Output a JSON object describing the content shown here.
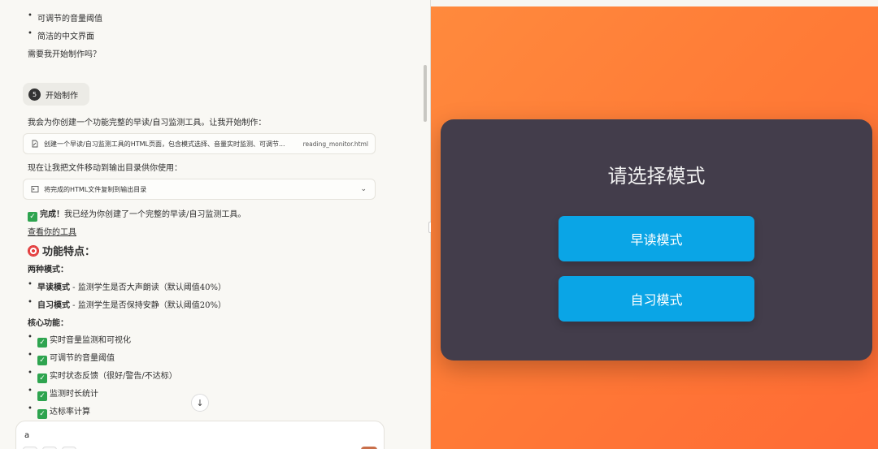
{
  "chat": {
    "lines_top": [
      "可调节的音量阈值",
      "简洁的中文界面"
    ],
    "question": "需要我开始制作吗？",
    "step": {
      "number": "5",
      "label": "开始制作"
    },
    "intro": "我会为你创建一个功能完整的早读/自习监测工具。让我开始制作：",
    "tool1": {
      "text": "创建一个早读/自习监测工具的HTML页面，包含模式选择、音量实时监测、可调节...",
      "file": "reading_monitor.html"
    },
    "move_text": "现在让我把文件移动到输出目录供你使用：",
    "tool2": {
      "text": "将完成的HTML文件复制到输出目录"
    },
    "done_bold": "完成！",
    "done_text": "我已经为你创建了一个完整的早读/自习监测工具。",
    "view_link": "查看你的工具",
    "features_heading": "功能特点：",
    "modes_heading": "两种模式：",
    "modes": [
      {
        "name": "早读模式",
        "desc": " - 监测学生是否大声朗读（默认阈值40%）"
      },
      {
        "name": "自习模式",
        "desc": " - 监测学生是否保持安静（默认阈值20%）"
      }
    ],
    "core_heading": "核心功能：",
    "core": [
      "实时音量监测和可视化",
      "可调节的音量阈值",
      "实时状态反馈（很好/警告/不达标）",
      "监测时长统计",
      "达标率计算"
    ],
    "composer_value": "a",
    "scroll_down_glyph": "↓",
    "check_glyph": "✓",
    "chevron_glyph": "⌄"
  },
  "preview": {
    "title": "请选择模式",
    "buttons": [
      "早读模式",
      "自习模式"
    ],
    "accent": "#0aa5e6",
    "modal_bg": "#433d4b",
    "bg": "#ff7a36"
  }
}
